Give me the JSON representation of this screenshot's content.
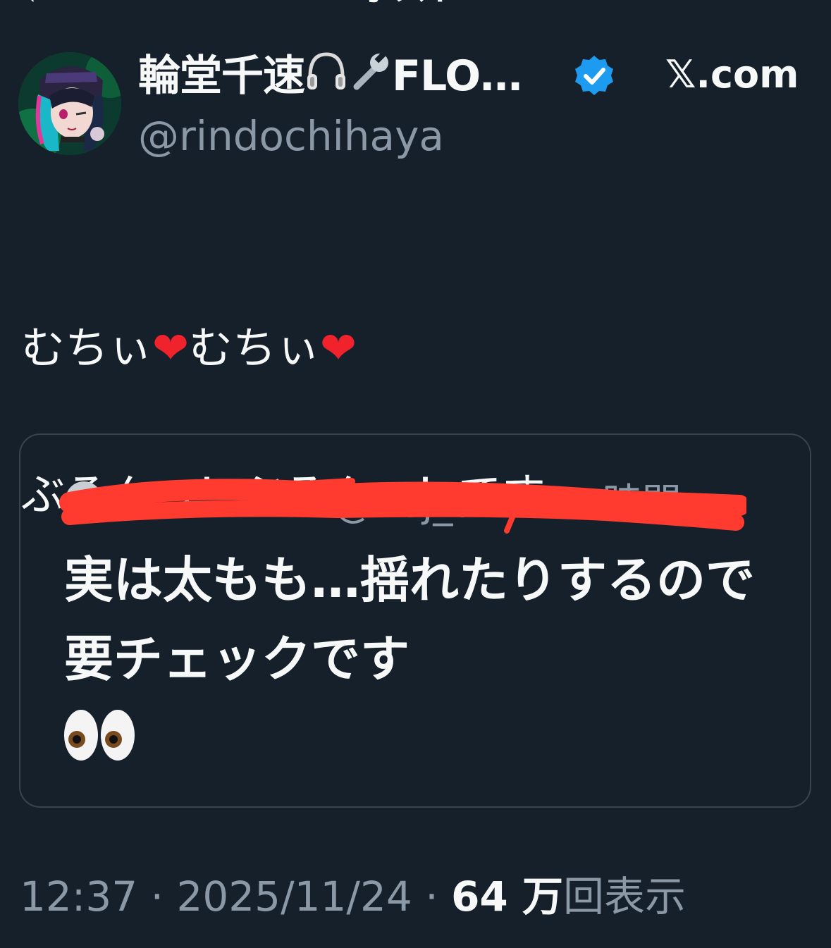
{
  "nav": {
    "title": "ポスト"
  },
  "author": {
    "display_name": "輪堂千速",
    "display_name_suffix": "FLO…",
    "handle": "@rindochihaya",
    "source": "𝕏.com",
    "icons": [
      "headphones-icon",
      "wrench-icon",
      "verified-badge-icon"
    ]
  },
  "tweet": {
    "line1_a": "むちぃ",
    "line1_b": "むちぃ",
    "line2": "ぶるんっ！ぶるんっ！です"
  },
  "quote": {
    "header_visible": "@noj_ad · 10 時間",
    "text": "実は太もも…揺れたりするので要チェックです"
  },
  "meta": {
    "time": "12:37",
    "date": "2025/11/24",
    "views_count": "64 万",
    "views_label": "回表示",
    "separator": "·"
  },
  "colors": {
    "background": "#15202b",
    "text": "#f7f9f9",
    "muted": "#8b98a5",
    "verified": "#1d9bf0",
    "heart": "#f0232c",
    "redaction": "#ff3b30"
  }
}
